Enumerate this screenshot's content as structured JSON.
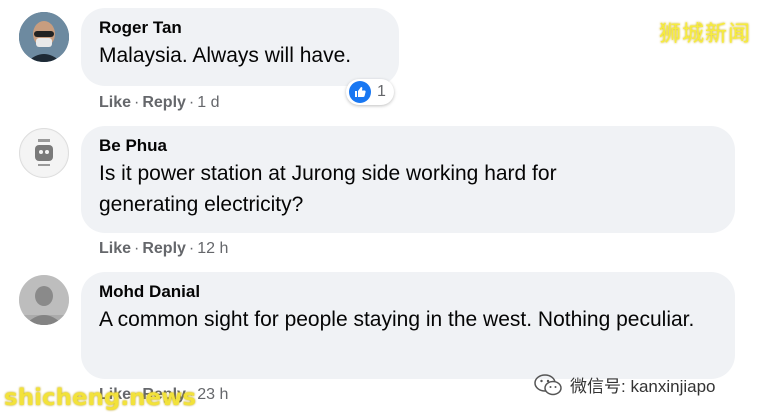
{
  "watermarks": {
    "top_right": "狮城新闻",
    "bottom_left": "shicheng.news",
    "wechat": "微信号: kanxinjiapo"
  },
  "comments": [
    {
      "name": "Roger Tan",
      "text": "Malaysia. Always will have.",
      "like": "Like",
      "reply": "Reply",
      "time": "1 d",
      "reaction_count": "1"
    },
    {
      "name": "Be Phua",
      "text": "Is it power station at Jurong side working hard for generating electricity?",
      "like": "Like",
      "reply": "Reply",
      "time": "12 h"
    },
    {
      "name": "Mohd Danial",
      "text": "A common sight for people staying in the west. Nothing peculiar.",
      "like": "Like",
      "reply": "Reply",
      "time": "23 h"
    }
  ],
  "colors": {
    "bubble": "#f0f2f5",
    "like_blue": "#1877f2",
    "meta_gray": "#65676b"
  }
}
